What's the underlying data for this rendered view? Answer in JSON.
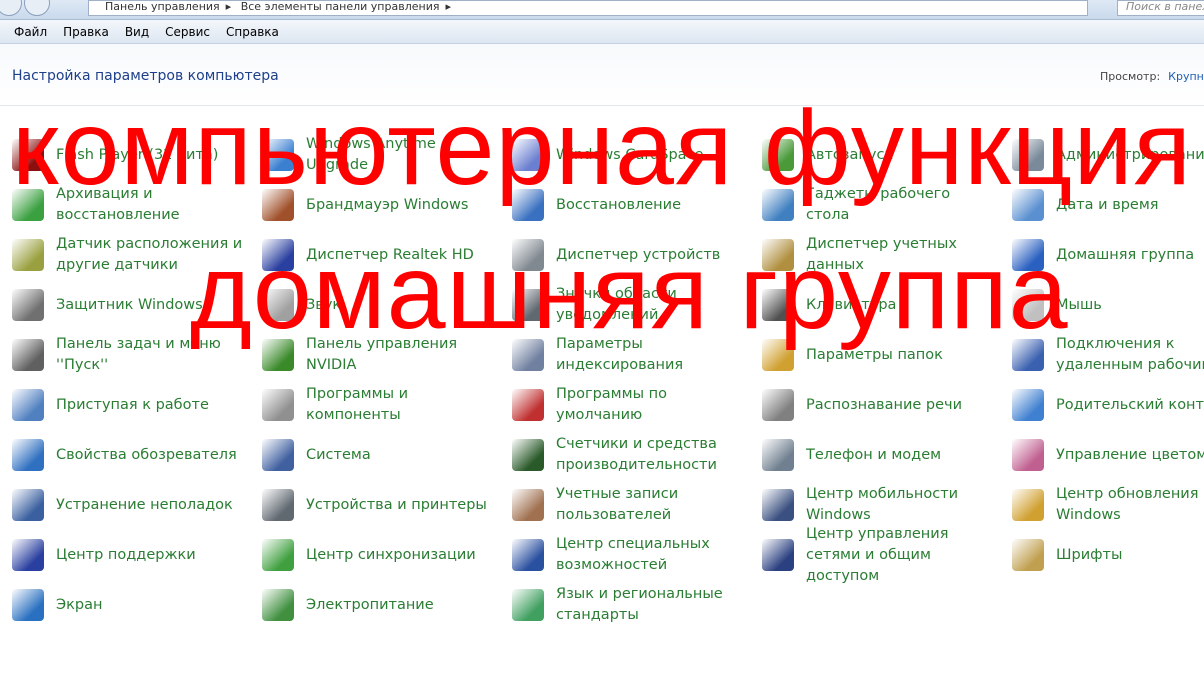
{
  "breadcrumb": [
    "Панель управления",
    "Все элементы панели управления"
  ],
  "search_placeholder": "Поиск в панели",
  "menu": [
    "Файл",
    "Правка",
    "Вид",
    "Сервис",
    "Справка"
  ],
  "title": "Настройка параметров компьютера",
  "view_label": "Просмотр:",
  "view_value": "Крупн",
  "items": [
    "Flash Player (32 бита)",
    "Windows Anytime Upgrade",
    "Windows CardSpace",
    "Автозапуск",
    "Администрирование",
    "Архивация и восстановление",
    "Брандмауэр Windows",
    "Восстановление",
    "Гаджеты рабочего стола",
    "Дата и время",
    "Датчик расположения и другие датчики",
    "Диспетчер Realtek HD",
    "Диспетчер устройств",
    "Диспетчер учетных данных",
    "Домашняя группа",
    "Защитник Windows",
    "Звук",
    "Значки области уведомлений",
    "Клавиатура",
    "Мышь",
    "Панель задач и меню ''Пуск''",
    "Панель управления NVIDIA",
    "Параметры индексирования",
    "Параметры папок",
    "Подключения к удаленным рабочим",
    "Приступая к работе",
    "Программы и компоненты",
    "Программы по умолчанию",
    "Распознавание речи",
    "Родительский контроль",
    "Свойства обозревателя",
    "Система",
    "Счетчики и средства производительности",
    "Телефон и модем",
    "Управление цветом",
    "Устранение неполадок",
    "Устройства и принтеры",
    "Учетные записи пользователей",
    "Центр мобильности Windows",
    "Центр обновления Windows",
    "Центр поддержки",
    "Центр синхронизации",
    "Центр специальных возможностей",
    "Центр управления сетями и общим доступом",
    "Шрифты",
    "Экран",
    "Электропитание",
    "Язык и региональные стандарты"
  ],
  "icon_colors": [
    "#8a1010",
    "#3a7fd0",
    "#6a7fd0",
    "#4a9a3a",
    "#7a8a9a",
    "#3aa040",
    "#a0502a",
    "#3a70c0",
    "#4080c0",
    "#5a90d0",
    "#9aa040",
    "#2a40a0",
    "#808890",
    "#b09040",
    "#2a60c0",
    "#707070",
    "#a0a0a0",
    "#606870",
    "#505050",
    "#c0c0c0",
    "#606060",
    "#3a8a2a",
    "#7080a0",
    "#d0a030",
    "#3a60b0",
    "#5080c0",
    "#909090",
    "#c03030",
    "#808080",
    "#4080d0",
    "#3070c0",
    "#4060a0",
    "#2a5a2a",
    "#708090",
    "#c06090",
    "#3a60a0",
    "#606870",
    "#a07050",
    "#3a5080",
    "#d0a030",
    "#2a40a0",
    "#40a040",
    "#2a50a0",
    "#2a4080",
    "#c0a050",
    "#2a70c0",
    "#409040",
    "#40a060"
  ],
  "overlay": {
    "line1": "компьютерная функция",
    "line2": "домашняя группа",
    "color": "#ff0000"
  }
}
